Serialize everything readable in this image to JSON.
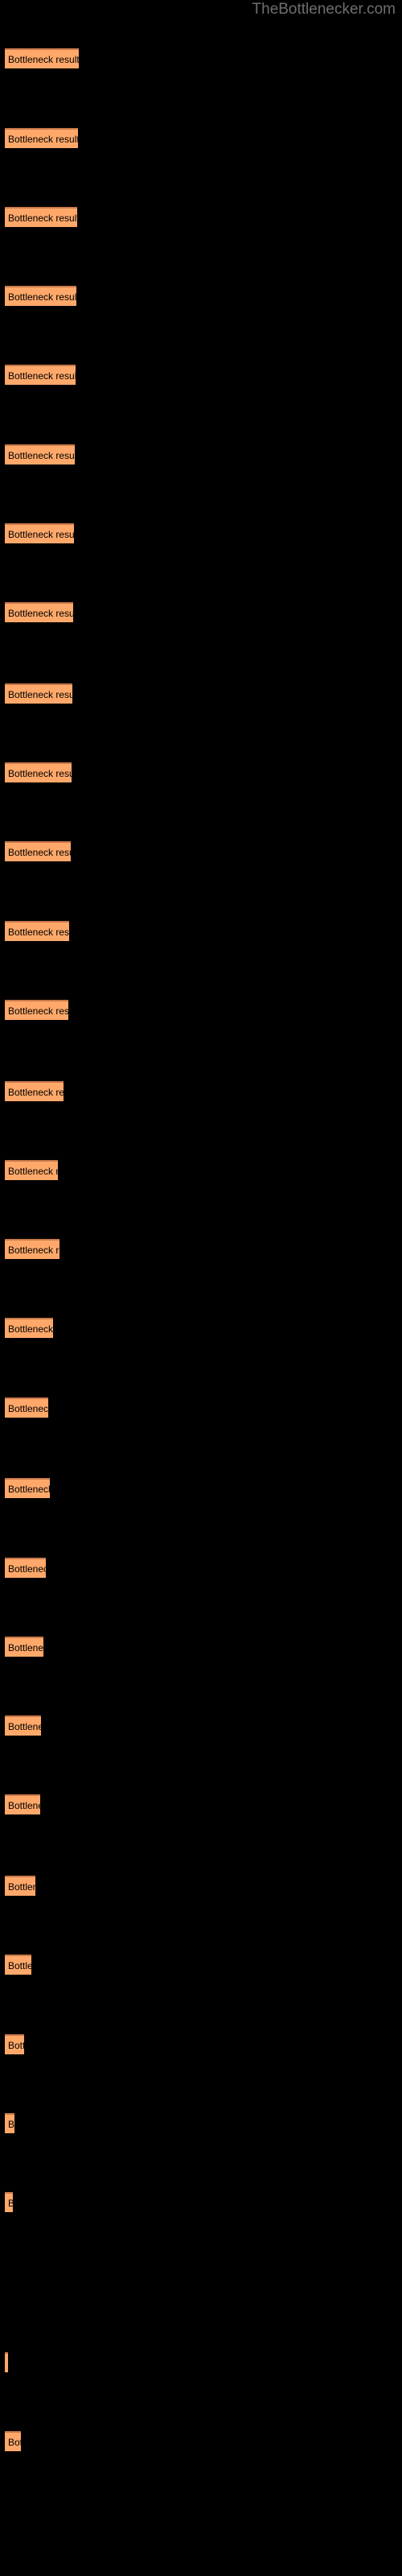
{
  "watermark": {
    "text": "TheBottlenecker.com"
  },
  "chart_data": {
    "type": "bar",
    "orientation": "horizontal",
    "title": "",
    "subtitle": "",
    "xlabel": "",
    "ylabel": "",
    "grid": false,
    "legend": null,
    "background_color": "#000000",
    "bar_color": "#FFA869",
    "bar_border_color": "#C8784A",
    "label_color": "#000000",
    "watermark_color": "#6e6e6e",
    "bar_label": "Bottleneck result",
    "xlim": [
      0,
      100
    ],
    "categories": [
      "Bottleneck result",
      "Bottleneck result",
      "Bottleneck result",
      "Bottleneck result",
      "Bottleneck result",
      "Bottleneck result",
      "Bottleneck result",
      "Bottleneck result",
      "Bottleneck result",
      "Bottleneck result",
      "Bottleneck result",
      "Bottleneck result",
      "Bottleneck result",
      "Bottleneck result",
      "Bottleneck result",
      "Bottleneck result",
      "Bottleneck result",
      "Bottleneck result",
      "Bottleneck result",
      "Bottleneck result",
      "Bottleneck result",
      "Bottleneck result",
      "Bottleneck result",
      "Bottleneck result",
      "Bottleneck result",
      "Bottleneck result",
      "Bottleneck result",
      "Bottleneck result",
      "Bottleneck result",
      "Bottleneck result"
    ],
    "values": [
      92,
      91,
      90,
      89,
      88,
      87,
      86,
      85,
      84,
      83,
      82,
      80,
      79,
      73,
      66,
      68,
      60,
      54,
      56,
      51,
      48,
      45,
      44,
      38,
      33,
      24,
      12,
      10,
      4,
      20
    ],
    "bars": [
      {
        "y": 57,
        "width": 92,
        "label": "Bottleneck result"
      },
      {
        "y": 100,
        "width": 91,
        "label": "Bottleneck result"
      },
      {
        "y": 143,
        "width": 90,
        "label": "Bottleneck result"
      },
      {
        "y": 186,
        "width": 89,
        "label": "Bottleneck result"
      },
      {
        "y": 229,
        "width": 88,
        "label": "Bottleneck result"
      },
      {
        "y": 272,
        "width": 87,
        "label": "Bottleneck result"
      },
      {
        "y": 315,
        "width": 86,
        "label": "Bottleneck result"
      },
      {
        "y": 358,
        "width": 85,
        "label": "Bottleneck result"
      },
      {
        "y": 402,
        "width": 84,
        "label": "Bottleneck result"
      },
      {
        "y": 445,
        "width": 83,
        "label": "Bottleneck result"
      },
      {
        "y": 488,
        "width": 82,
        "label": "Bottleneck result"
      },
      {
        "y": 531,
        "width": 80,
        "label": "Bottleneck result"
      },
      {
        "y": 574,
        "width": 79,
        "label": "Bottleneck result"
      },
      {
        "y": 618,
        "width": 73,
        "label": "Bottleneck result"
      },
      {
        "y": 661,
        "width": 66,
        "label": "Bottleneck result"
      },
      {
        "y": 704,
        "width": 68,
        "label": "Bottleneck result"
      },
      {
        "y": 747,
        "width": 60,
        "label": "Bottleneck result"
      },
      {
        "y": 790,
        "width": 54,
        "label": "Bottleneck result"
      },
      {
        "y": 834,
        "width": 56,
        "label": "Bottleneck result"
      },
      {
        "y": 877,
        "width": 51,
        "label": "Bottleneck result"
      },
      {
        "y": 920,
        "width": 48,
        "label": "Bottleneck result"
      },
      {
        "y": 963,
        "width": 45,
        "label": "Bottleneck result"
      },
      {
        "y": 1006,
        "width": 44,
        "label": "Bottleneck result"
      },
      {
        "y": 1050,
        "width": 38,
        "label": "Bottleneck result"
      },
      {
        "y": 1093,
        "width": 33,
        "label": "Bottleneck result"
      },
      {
        "y": 1136,
        "width": 24,
        "label": "Bottleneck result"
      },
      {
        "y": 1179,
        "width": 12,
        "label": "Bottleneck result"
      },
      {
        "y": 1222,
        "width": 10,
        "label": "Bottleneck result"
      },
      {
        "y": 1309,
        "width": 4,
        "label": "Bottleneck result"
      },
      {
        "y": 1352,
        "width": 20,
        "label": "Bottleneck result"
      }
    ]
  }
}
